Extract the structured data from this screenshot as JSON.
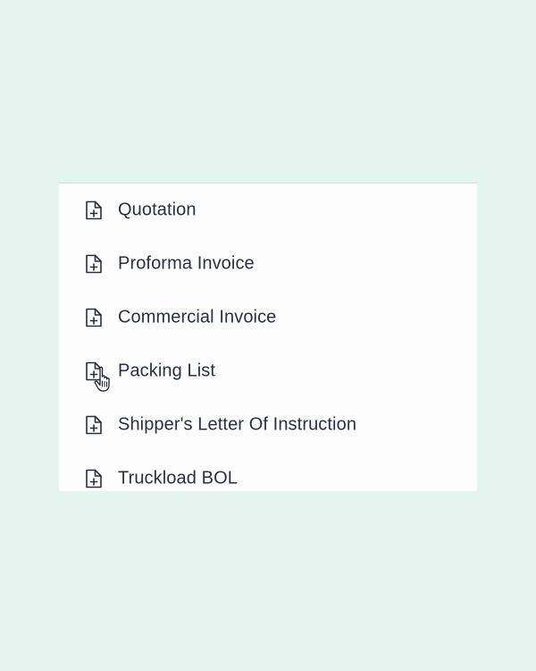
{
  "menu": {
    "items": [
      {
        "label": "Quotation",
        "icon": "file-plus-icon"
      },
      {
        "label": "Proforma Invoice",
        "icon": "file-plus-icon"
      },
      {
        "label": "Commercial Invoice",
        "icon": "file-plus-icon"
      },
      {
        "label": "Packing List",
        "icon": "file-plus-icon"
      },
      {
        "label": "Shipper's Letter Of Instruction",
        "icon": "file-plus-icon"
      },
      {
        "label": "Truckload BOL",
        "icon": "file-plus-icon"
      }
    ]
  },
  "colors": {
    "background": "#e4f4ef",
    "panel": "#fdfdfd",
    "text": "#2b3040",
    "icon_stroke": "#2b3040"
  }
}
